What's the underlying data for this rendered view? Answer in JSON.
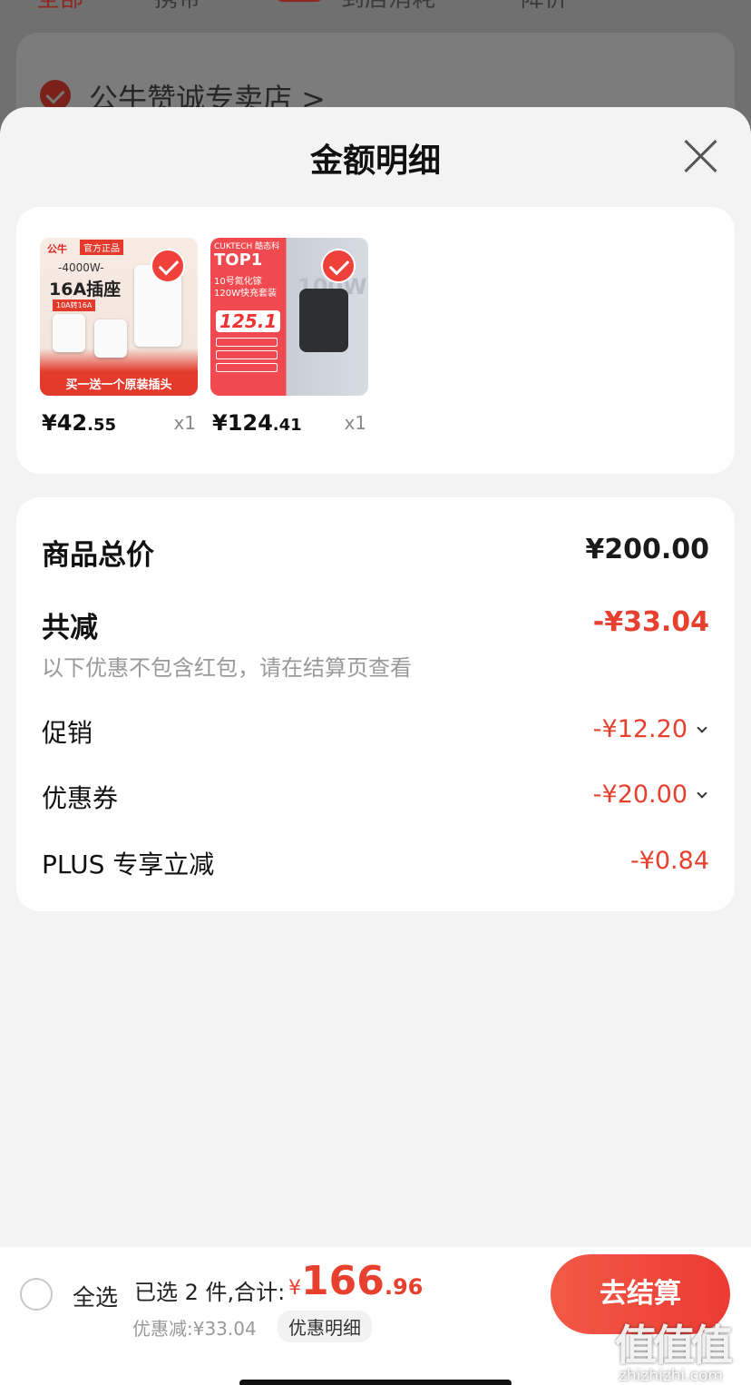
{
  "background": {
    "tabs": [
      "全部",
      "携带",
      "到店消耗",
      "降价"
    ],
    "store_name": "公牛赞诚专卖店 >"
  },
  "sheet": {
    "title": "金额明细"
  },
  "products": [
    {
      "price_int": "¥42",
      "price_dec": ".55",
      "qty": "x1",
      "thumb": {
        "brand": "公牛",
        "badge": "官方正品",
        "watt": "-4000W-",
        "main": "16A插座",
        "sub": "10A转16A",
        "bottom": "买一送一个原装插头"
      }
    },
    {
      "price_int": "¥124",
      "price_dec": ".41",
      "qty": "x1",
      "thumb": {
        "brand": "CUKTECH 酷态科",
        "top": "TOP1",
        "line1": "10号氮化镓 120W快充套装",
        "price": "125.1",
        "watt": "100W"
      }
    }
  ],
  "summary": {
    "total_label": "商品总价",
    "total_value": "¥200.00",
    "reduction_label": "共减",
    "reduction_value": "-¥33.04",
    "hint": "以下优惠不包含红包，请在结算页查看",
    "items": [
      {
        "label": "促销",
        "value": "-¥12.20"
      },
      {
        "label": "优惠券",
        "value": "-¥20.00"
      },
      {
        "label": "PLUS 专享立减",
        "value": "-¥0.84"
      }
    ]
  },
  "bottom_bar": {
    "select_all": "全选",
    "selected_text": "已选 2 件,合计:",
    "yen": "¥",
    "total_int": "166",
    "total_dec": ".96",
    "discount_text": "优惠减:¥33.04",
    "detail_link": "优惠明细",
    "checkout": "去结算"
  },
  "watermark": {
    "main": "值值值",
    "sub": "zhizhizhi.com"
  },
  "colors": {
    "accent": "#e8402f",
    "sheet_bg": "#f3f3f3",
    "card_bg": "#ffffff"
  }
}
